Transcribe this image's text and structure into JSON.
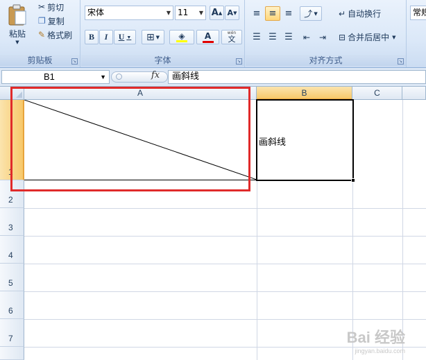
{
  "ribbon": {
    "clipboard": {
      "paste_label": "粘贴",
      "cut_label": "剪切",
      "copy_label": "复制",
      "format_painter_label": "格式刷",
      "group_label": "剪贴板"
    },
    "font": {
      "font_name": "宋体",
      "font_size": "11",
      "bold": "B",
      "italic": "I",
      "underline": "U",
      "grow_font": "A",
      "shrink_font": "A",
      "font_color_letter": "A",
      "phonetic_label": "文",
      "phonetic_top": "wén",
      "group_label": "字体",
      "font_color": "#e00000"
    },
    "alignment": {
      "wrap_text_label": "自动换行",
      "merge_center_label": "合并后居中",
      "group_label": "对齐方式"
    },
    "number": {
      "format_label": "常规"
    }
  },
  "formula_bar": {
    "name_box": "B1",
    "fx": "fx",
    "formula": "画斜线"
  },
  "grid": {
    "columns": [
      "A",
      "B",
      "C"
    ],
    "rows": [
      "1",
      "2",
      "3",
      "4",
      "5",
      "6",
      "7"
    ],
    "selected_cell": "B1",
    "cells": {
      "B1": "画斜线"
    }
  },
  "watermark": {
    "text": "Bai 经验",
    "url": "jingyan.baidu.com"
  }
}
